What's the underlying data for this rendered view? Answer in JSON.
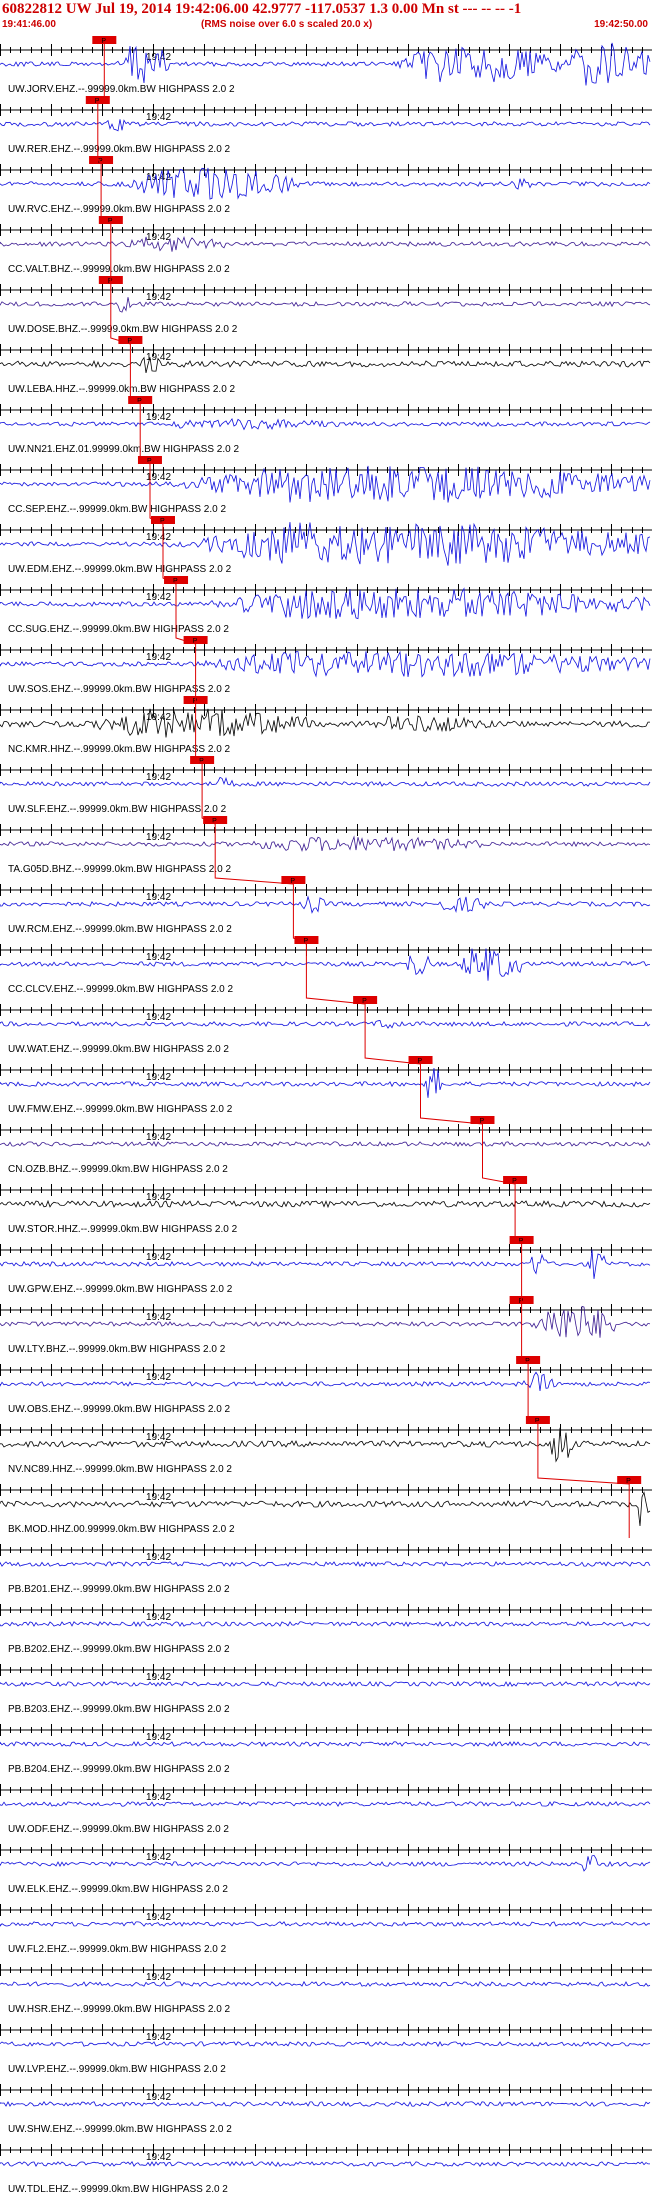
{
  "header": {
    "title": "60822812 UW Jul 19, 2014 19:42:06.00   42.9777 -117.0537  1.3 0.00 Mn st --- -- --  -1",
    "start_time": "19:41:46.00",
    "note": "(RMS noise over 6.0 s scaled 20.0 x)",
    "end_time": "19:42:50.00"
  },
  "colors": {
    "title": "#cc0000",
    "blue_trace": "#1010dd",
    "purple_trace": "#3a1a90",
    "black_trace": "#000000",
    "pick_marker": "#dd0000",
    "pick_line": "#dd0000",
    "axis": "#000000"
  },
  "chart_data": {
    "type": "line",
    "title": "60822812 UW Jul 19, 2014 19:42:06.00   42.9777 -117.0537  1.3 0.00 Mn st --- -- --  -1",
    "x_range": [
      "19:41:46.00",
      "19:42:50.00"
    ],
    "x_tick_label": "19:42",
    "grid": false,
    "traces": [
      {
        "label": "UW.JORV.EHZ.--.99999.0km.BW  HIGHPASS  2.0  2",
        "color": "blue",
        "pick_marker": "P",
        "pick_pos": 0.16,
        "bursts": [
          [
            0.18,
            0.26,
            1.0
          ],
          [
            0.6,
            0.86,
            0.85
          ],
          [
            0.86,
            1.0,
            1.0
          ]
        ]
      },
      {
        "label": "UW.RER.EHZ.--.99999.0km.BW  HIGHPASS  2.0  2",
        "color": "blue",
        "pick_marker": "P",
        "pick_pos": 0.15,
        "bursts": [
          [
            0.16,
            0.2,
            0.35
          ]
        ]
      },
      {
        "label": "UW.RVC.EHZ.--.99999.0km.BW  HIGHPASS  2.0  2",
        "color": "blue",
        "pick_marker": "P",
        "pick_pos": 0.155,
        "bursts": [
          [
            0.18,
            0.46,
            0.8
          ],
          [
            0.78,
            0.82,
            0.3
          ]
        ]
      },
      {
        "label": "CC.VALT.BHZ.--.99999.0km.BW  HIGHPASS  2.0  2",
        "color": "purple",
        "pick_marker": "P",
        "pick_pos": 0.17,
        "bursts": [
          [
            0.18,
            0.35,
            0.35
          ]
        ]
      },
      {
        "label": "UW.DOSE.BHZ.--.99999.0km.BW  HIGHPASS  2.0  2",
        "color": "purple",
        "pick_marker": "P",
        "pick_pos": 0.17,
        "bursts": [
          [
            0.18,
            0.2,
            0.6
          ]
        ]
      },
      {
        "label": "UW.LEBA.HHZ.--.99999.0km.BW  HIGHPASS  2.0  2",
        "color": "black",
        "pick_marker": "P",
        "pick_pos": 0.2,
        "bursts": [
          [
            0.21,
            0.25,
            0.5
          ]
        ]
      },
      {
        "label": "UW.NN21.EHZ.01.99999.0km.BW  HIGHPASS  2.0  2",
        "color": "blue",
        "pick_marker": "P",
        "pick_pos": 0.215,
        "bursts": [
          [
            0.22,
            0.52,
            0.25
          ]
        ]
      },
      {
        "label": "CC.SEP.EHZ.--.99999.0km.BW  HIGHPASS  2.0  2",
        "color": "blue",
        "pick_marker": "P",
        "pick_pos": 0.23,
        "bursts": [
          [
            0.24,
            1.0,
            0.85
          ]
        ]
      },
      {
        "label": "UW.EDM.EHZ.--.99999.0km.BW  HIGHPASS  2.0  2",
        "color": "blue",
        "pick_marker": "P",
        "pick_pos": 0.25,
        "bursts": [
          [
            0.26,
            1.0,
            1.0
          ]
        ]
      },
      {
        "label": "CC.SUG.EHZ.--.99999.0km.BW  HIGHPASS  2.0  2",
        "color": "blue",
        "pick_marker": "P",
        "pick_pos": 0.27,
        "bursts": [
          [
            0.28,
            1.0,
            0.7
          ]
        ]
      },
      {
        "label": "UW.SOS.EHZ.--.99999.0km.BW  HIGHPASS  2.0  2",
        "color": "blue",
        "pick_marker": "P",
        "pick_pos": 0.3,
        "bursts": [
          [
            0.26,
            1.0,
            0.6
          ]
        ]
      },
      {
        "label": "NC.KMR.HHZ.--.99999.0km.BW  HIGHPASS  2.0  2",
        "color": "black",
        "pick_marker": "P",
        "pick_pos": 0.3,
        "bursts": [
          [
            0.12,
            0.48,
            0.7
          ],
          [
            0.55,
            0.75,
            0.4
          ]
        ]
      },
      {
        "label": "UW.SLF.EHZ.--.99999.0km.BW  HIGHPASS  2.0  2",
        "color": "blue",
        "pick_marker": "P",
        "pick_pos": 0.31,
        "bursts": [
          [
            0.32,
            0.36,
            0.3
          ]
        ]
      },
      {
        "label": "TA.G05D.BHZ.--.99999.0km.BW  HIGHPASS  2.0  2",
        "color": "purple",
        "pick_marker": "P",
        "pick_pos": 0.33,
        "bursts": [
          [
            0.34,
            0.75,
            0.35
          ]
        ]
      },
      {
        "label": "UW.RCM.EHZ.--.99999.0km.BW  HIGHPASS  2.0  2",
        "color": "blue",
        "pick_marker": "P",
        "pick_pos": 0.45,
        "bursts": [
          [
            0.46,
            0.5,
            0.4
          ],
          [
            0.66,
            0.76,
            0.35
          ]
        ]
      },
      {
        "label": "CC.CLCV.EHZ.--.99999.0km.BW  HIGHPASS  2.0  2",
        "color": "blue",
        "pick_marker": "P",
        "pick_pos": 0.47,
        "bursts": [
          [
            0.62,
            0.66,
            0.6
          ],
          [
            0.7,
            0.8,
            0.8
          ]
        ]
      },
      {
        "label": "UW.WAT.EHZ.--.99999.0km.BW  HIGHPASS  2.0  2",
        "color": "blue",
        "pick_marker": "P",
        "pick_pos": 0.56,
        "bursts": [
          [
            0.57,
            0.62,
            0.25
          ]
        ]
      },
      {
        "label": "UW.FMW.EHZ.--.99999.0km.BW  HIGHPASS  2.0  2",
        "color": "blue",
        "pick_marker": "P",
        "pick_pos": 0.645,
        "bursts": [
          [
            0.65,
            0.68,
            0.8
          ]
        ]
      },
      {
        "label": "CN.OZB.BHZ.--.99999.0km.BW  HIGHPASS  2.0  2",
        "color": "purple",
        "pick_marker": "P",
        "pick_pos": 0.74,
        "bursts": []
      },
      {
        "label": "UW.STOR.HHZ.--.99999.0km.BW  HIGHPASS  2.0  2",
        "color": "black",
        "pick_marker": "P",
        "pick_pos": 0.79,
        "bursts": []
      },
      {
        "label": "UW.GPW.EHZ.--.99999.0km.BW  HIGHPASS  2.0  2",
        "color": "blue",
        "pick_marker": "P",
        "pick_pos": 0.8,
        "bursts": [
          [
            0.81,
            0.84,
            0.6
          ],
          [
            0.9,
            0.93,
            0.7
          ]
        ]
      },
      {
        "label": "UW.LTY.BHZ.--.99999.0km.BW  HIGHPASS  2.0  2",
        "color": "purple",
        "pick_marker": "P",
        "pick_pos": 0.8,
        "bursts": [
          [
            0.81,
            0.95,
            0.9
          ]
        ]
      },
      {
        "label": "UW.OBS.EHZ.--.99999.0km.BW  HIGHPASS  2.0  2",
        "color": "blue",
        "pick_marker": "P",
        "pick_pos": 0.81,
        "bursts": [
          [
            0.8,
            0.85,
            0.55
          ]
        ]
      },
      {
        "label": "NV.NC89.HHZ.--.99999.0km.BW  HIGHPASS  2.0  2",
        "color": "black",
        "pick_marker": "P",
        "pick_pos": 0.825,
        "bursts": [
          [
            0.84,
            0.88,
            1.0
          ]
        ]
      },
      {
        "label": "BK.MOD.HHZ.00.99999.0km.BW  HIGHPASS  2.0  2",
        "color": "black",
        "pick_marker": "P",
        "pick_pos": 0.965,
        "bursts": [
          [
            0.975,
            1.0,
            1.0
          ]
        ]
      },
      {
        "label": "PB.B201.EHZ.--.99999.0km.BW  HIGHPASS  2.0  2",
        "color": "blue",
        "pick_marker": "",
        "pick_pos": null,
        "bursts": []
      },
      {
        "label": "PB.B202.EHZ.--.99999.0km.BW  HIGHPASS  2.0  2",
        "color": "blue",
        "pick_marker": "",
        "pick_pos": null,
        "bursts": []
      },
      {
        "label": "PB.B203.EHZ.--.99999.0km.BW  HIGHPASS  2.0  2",
        "color": "blue",
        "pick_marker": "",
        "pick_pos": null,
        "bursts": []
      },
      {
        "label": "PB.B204.EHZ.--.99999.0km.BW  HIGHPASS  2.0  2",
        "color": "blue",
        "pick_marker": "",
        "pick_pos": null,
        "bursts": []
      },
      {
        "label": "UW.ODF.EHZ.--.99999.0km.BW  HIGHPASS  2.0  2",
        "color": "blue",
        "pick_marker": "",
        "pick_pos": null,
        "bursts": []
      },
      {
        "label": "UW.ELK.EHZ.--.99999.0km.BW  HIGHPASS  2.0  2",
        "color": "blue",
        "pick_marker": "",
        "pick_pos": null,
        "bursts": [
          [
            0.89,
            0.92,
            0.5
          ]
        ]
      },
      {
        "label": "UW.FL2.EHZ.--.99999.0km.BW  HIGHPASS  2.0  2",
        "color": "blue",
        "pick_marker": "",
        "pick_pos": null,
        "bursts": []
      },
      {
        "label": "UW.HSR.EHZ.--.99999.0km.BW  HIGHPASS  2.0  2",
        "color": "blue",
        "pick_marker": "",
        "pick_pos": null,
        "bursts": []
      },
      {
        "label": "UW.LVP.EHZ.--.99999.0km.BW  HIGHPASS  2.0  2",
        "color": "blue",
        "pick_marker": "",
        "pick_pos": null,
        "bursts": []
      },
      {
        "label": "UW.SHW.EHZ.--.99999.0km.BW  HIGHPASS  2.0  2",
        "color": "blue",
        "pick_marker": "",
        "pick_pos": null,
        "bursts": []
      },
      {
        "label": "UW.TDL.EHZ.--.99999.0km.BW  HIGHPASS  2.0  2",
        "color": "blue",
        "pick_marker": "",
        "pick_pos": null,
        "bursts": []
      }
    ]
  }
}
